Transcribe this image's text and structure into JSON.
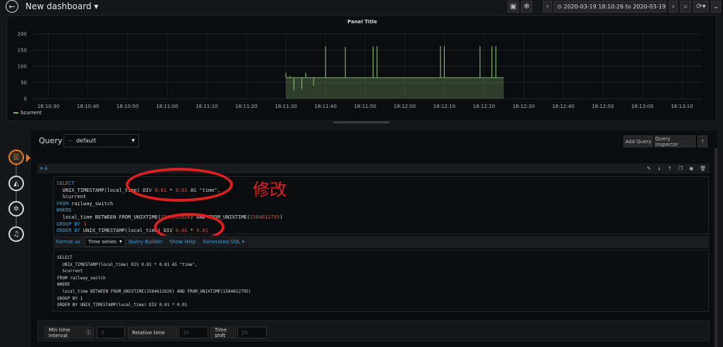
{
  "topbar": {
    "back_icon": "arrow-left-icon",
    "title": "New dashboard ▾",
    "save_icon": "save-icon",
    "settings_icon": "gear-icon",
    "time_range": "⊙ 2020-03-19 18:10:26 to 2020-03-19 18:13:15 ▾",
    "zoom_icon": "zoom-out-icon",
    "refresh_icon": "refresh-icon"
  },
  "panel": {
    "title": "Panel Title",
    "y_ticks": [
      "200",
      "150",
      "100",
      "50",
      "0"
    ],
    "x_ticks": [
      "18:10:30",
      "18:10:40",
      "18:10:50",
      "18:11:00",
      "18:11:10",
      "18:11:20",
      "18:11:30",
      "18:11:40",
      "18:11:50",
      "18:12:00",
      "18:12:10",
      "18:12:20",
      "18:12:30",
      "18:12:40",
      "18:12:50",
      "18:13:00",
      "18:13:10"
    ],
    "legend": "Scurrent"
  },
  "chart_data": {
    "type": "area",
    "ylim": [
      0,
      200
    ],
    "y_ticks": [
      0,
      50,
      100,
      150,
      200
    ],
    "x_range": [
      "18:10:26",
      "18:13:15"
    ],
    "series": [
      {
        "name": "Scurrent",
        "color": "#7eb26d",
        "baseline": {
          "from": "18:11:30",
          "to": "18:12:25",
          "value": 65
        },
        "spikes": [
          {
            "t": "18:11:30",
            "v": 80
          },
          {
            "t": "18:11:31",
            "v": 70
          },
          {
            "t": "18:11:32",
            "v": 25
          },
          {
            "t": "18:11:34",
            "v": 30
          },
          {
            "t": "18:11:35",
            "v": 80
          },
          {
            "t": "18:11:37",
            "v": 40
          },
          {
            "t": "18:11:40",
            "v": 162
          },
          {
            "t": "18:11:45",
            "v": 160
          },
          {
            "t": "18:11:52",
            "v": 162
          },
          {
            "t": "18:11:53",
            "v": 162
          },
          {
            "t": "18:12:09",
            "v": 162
          },
          {
            "t": "18:12:10",
            "v": 162
          },
          {
            "t": "18:12:19",
            "v": 162
          },
          {
            "t": "18:12:22",
            "v": 162
          },
          {
            "t": "18:12:23",
            "v": 162
          }
        ]
      }
    ]
  },
  "sidebar": {
    "icons": [
      "database-icon",
      "chart-icon",
      "gear-icon",
      "bell-icon"
    ]
  },
  "query": {
    "label": "Query",
    "datasource": "default",
    "add_query": "Add Query",
    "query_inspector": "Query Inspector",
    "help": "?",
    "row_label": "▾ A",
    "annotation_text": "修改",
    "sql_lines": [
      "SELECT",
      "  UNIX_TIMESTAMP(local_time) DIV 0.01 * 0.01 AS \"time\",",
      "  Scurrent",
      "FROM railway_switch",
      "WHERE",
      "  local_time BETWEEN FROM_UNIXTIME(1584612626) AND FROM_UNIXTIME(1584612795)",
      "GROUP BY 1",
      "ORDER BY UNIX_TIMESTAMP(local_time) DIV 0.01 * 0.01"
    ],
    "format_as_label": "Format as",
    "format_as_value": "Time series",
    "query_builder": "Query Builder",
    "show_help": "Show Help",
    "generated_sql": "Generated SQL ▾",
    "preview": "SELECT\n  UNIX_TIMESTAMP(local_time) DIV 0.01 * 0.01 AS \"time\",\n  Scurrent\nFROM railway_switch\nWHERE\n  local_time BETWEEN FROM_UNIXTIME(1584612626) AND FROM_UNIXTIME(1584612795)\nGROUP BY 1\nORDER BY UNIX_TIMESTAMP(local_time) DIV 0.01 * 0.01"
  },
  "options": {
    "min_interval_label": "Min time interval",
    "min_interval_placeholder": "0",
    "relative_time_label": "Relative time",
    "relative_time_placeholder": "1h",
    "time_shift_label": "Time shift",
    "time_shift_placeholder": "1h"
  }
}
